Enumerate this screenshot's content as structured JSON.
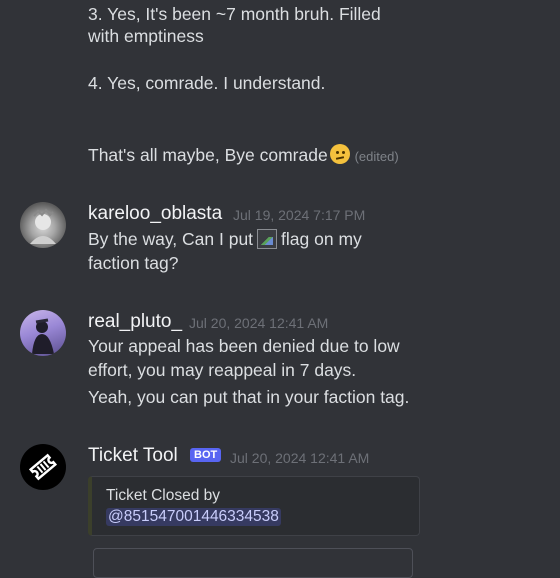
{
  "messages": {
    "intro": {
      "line3a": "3. Yes, It's been ~7 month bruh. Filled",
      "line3b": "with emptiness",
      "line4": "4. Yes, comrade. I understand.",
      "closing": "That's all maybe, Bye comrade",
      "emoji": "confused-face-emoji",
      "edited": "(edited)"
    },
    "kareloo": {
      "username": "kareloo_oblasta",
      "timestamp": "Jul 19, 2024 7:17 PM",
      "text_a": "By the way, Can I put",
      "text_b": "flag on my",
      "text_c": "faction tag?",
      "inline_image": "flag-image"
    },
    "pluto": {
      "username": "real_pluto_",
      "timestamp": "Jul 20, 2024 12:41 AM",
      "text_a": "Your appeal has been denied due to low",
      "text_b": "effort, you may reappeal in 7 days.",
      "text_c": "Yeah, you can put that in your faction tag."
    },
    "ticket": {
      "username": "Ticket Tool",
      "badge": "BOT",
      "timestamp": "Jul 20, 2024 12:41 AM",
      "embed_title": "Ticket Closed by",
      "embed_mention": "@851547001446334538"
    }
  },
  "colors": {
    "background": "#313338",
    "text": "#dbdee1",
    "mention": "#c9cdfb",
    "bot_badge": "#5865f2"
  }
}
